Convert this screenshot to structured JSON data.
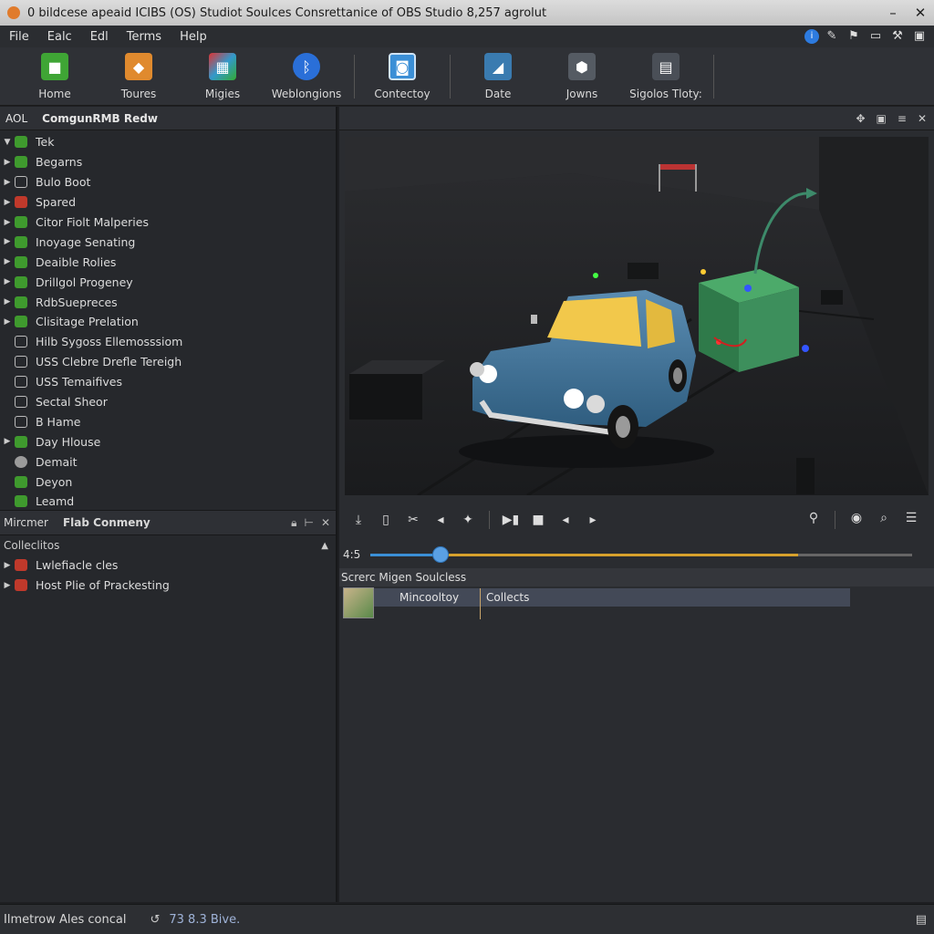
{
  "window": {
    "title": "0 bildcese apeaid ICIBS (OS) Studiot Soulces Consrettanice of OBS Studio 8,257 agrolut",
    "minimize": "–",
    "close": "✕"
  },
  "menu": [
    "File",
    "Ealc",
    "Edl",
    "Terms",
    "Help"
  ],
  "toolbar": [
    {
      "label": "Home",
      "icon": "home-icon",
      "color": "#3fa535"
    },
    {
      "label": "Toures",
      "icon": "toures-icon",
      "color": "#e08a2e"
    },
    {
      "label": "Migies",
      "icon": "migies-icon",
      "color": "#8a4fc8"
    },
    {
      "label": "Weblongions",
      "icon": "bluetooth-icon",
      "color": "#2a6fd8"
    },
    {
      "label": "Contectoy",
      "icon": "contectoy-icon",
      "color": "#3b8fd6"
    },
    {
      "label": "Date",
      "icon": "date-icon",
      "color": "#3a7bb0"
    },
    {
      "label": "Jowns",
      "icon": "jowns-icon",
      "color": "#555b63"
    },
    {
      "label": "Sigolos Tloty:",
      "icon": "sigolos-icon",
      "color": "#4a4f57"
    }
  ],
  "left_pane": {
    "header_a": "AOL",
    "header_b": "ComgunRMB Redw",
    "tree": [
      {
        "label": "Tek",
        "arrow": "▼",
        "icon": "green"
      },
      {
        "label": "Begarns",
        "arrow": "▶",
        "icon": "green"
      },
      {
        "label": "Bulo Boot",
        "arrow": "▶",
        "icon": "gray"
      },
      {
        "label": "Spared",
        "arrow": "▶",
        "icon": "red"
      },
      {
        "label": "Citor Fiolt Malperies",
        "arrow": "▶",
        "icon": "green"
      },
      {
        "label": "Inoyage Senating",
        "arrow": "▶",
        "icon": "green"
      },
      {
        "label": "Deaible Rolies",
        "arrow": "▶",
        "icon": "green"
      },
      {
        "label": "Drillgol Progeney",
        "arrow": "▶",
        "icon": "green"
      },
      {
        "label": "RdbSuepreces",
        "arrow": "▶",
        "icon": "green"
      },
      {
        "label": "Clisitage Prelation",
        "arrow": "▶",
        "icon": "green"
      },
      {
        "label": "Hilb Sygoss Ellemosssiom",
        "arrow": "",
        "icon": "gray"
      },
      {
        "label": "USS Clebre Drefle Tereigh",
        "arrow": "",
        "icon": "gray"
      },
      {
        "label": "USS Temaifives",
        "arrow": "",
        "icon": "gray"
      },
      {
        "label": "Sectal Sheor",
        "arrow": "",
        "icon": "gray"
      },
      {
        "label": "B Hame",
        "arrow": "",
        "icon": "gray"
      },
      {
        "label": "Day Hlouse",
        "arrow": "▶",
        "icon": "green"
      },
      {
        "label": "Demait",
        "arrow": "",
        "icon": "light"
      },
      {
        "label": "Deyon",
        "arrow": "",
        "icon": "green"
      },
      {
        "label": "Leamd",
        "arrow": "",
        "icon": "green"
      }
    ],
    "sub_header_a": "Mircmer",
    "sub_header_b": "Flab Conmeny",
    "collections_label": "Colleclitos",
    "collections": [
      {
        "label": "Lwlefiacle cles"
      },
      {
        "label": "Host Plie of Prackesting"
      }
    ]
  },
  "right_pane": {
    "timeline_label": "4:5",
    "timeline_position": 0.13,
    "timeline_buffered": 0.79,
    "sources_header": "Screrc Migen Soulcless",
    "source_row": {
      "col1": "Mincooltoy",
      "col2": "Collects"
    }
  },
  "status": {
    "left": "Ilmetrow Ales concal",
    "middle": "73 8.3 Bive."
  }
}
